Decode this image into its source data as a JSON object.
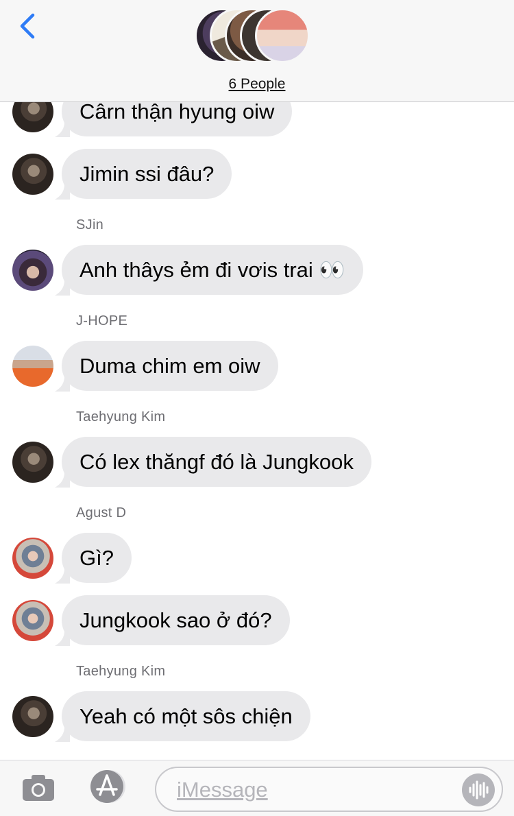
{
  "header": {
    "group_label": "6 People",
    "back_icon": "chevron-left-icon",
    "accent": "#2f7cf6"
  },
  "messages": [
    {
      "sender": "",
      "avatar": "taehyung",
      "text": "Cârn thận hyung oiw"
    },
    {
      "sender": "",
      "avatar": "taehyung",
      "text": "Jimin ssi đâu?"
    },
    {
      "sender": "SJin",
      "avatar": "jin",
      "text": "Anh thâys ẻm đi vơis trai 👀"
    },
    {
      "sender": "J-HOPE",
      "avatar": "hope",
      "text": "Duma chim em oiw"
    },
    {
      "sender": "Taehyung Kim",
      "avatar": "taehyung",
      "text": "Có lex thăngf đó là Jungkook"
    },
    {
      "sender": "Agust D",
      "avatar": "agust",
      "text": "Gì?"
    },
    {
      "sender": "",
      "avatar": "agust",
      "text": "Jungkook sao ở đó?"
    },
    {
      "sender": "Taehyung Kim",
      "avatar": "taehyung",
      "text": "Yeah có một sôs chiện"
    }
  ],
  "composer": {
    "placeholder": "iMessage",
    "camera_icon": "camera-icon",
    "apps_icon": "app-store-icon",
    "audio_icon": "audio-waveform-icon"
  },
  "colors": {
    "bubble": "#e9e9eb",
    "sender_text": "#6e6e73",
    "header_bg": "#f7f7f7"
  }
}
